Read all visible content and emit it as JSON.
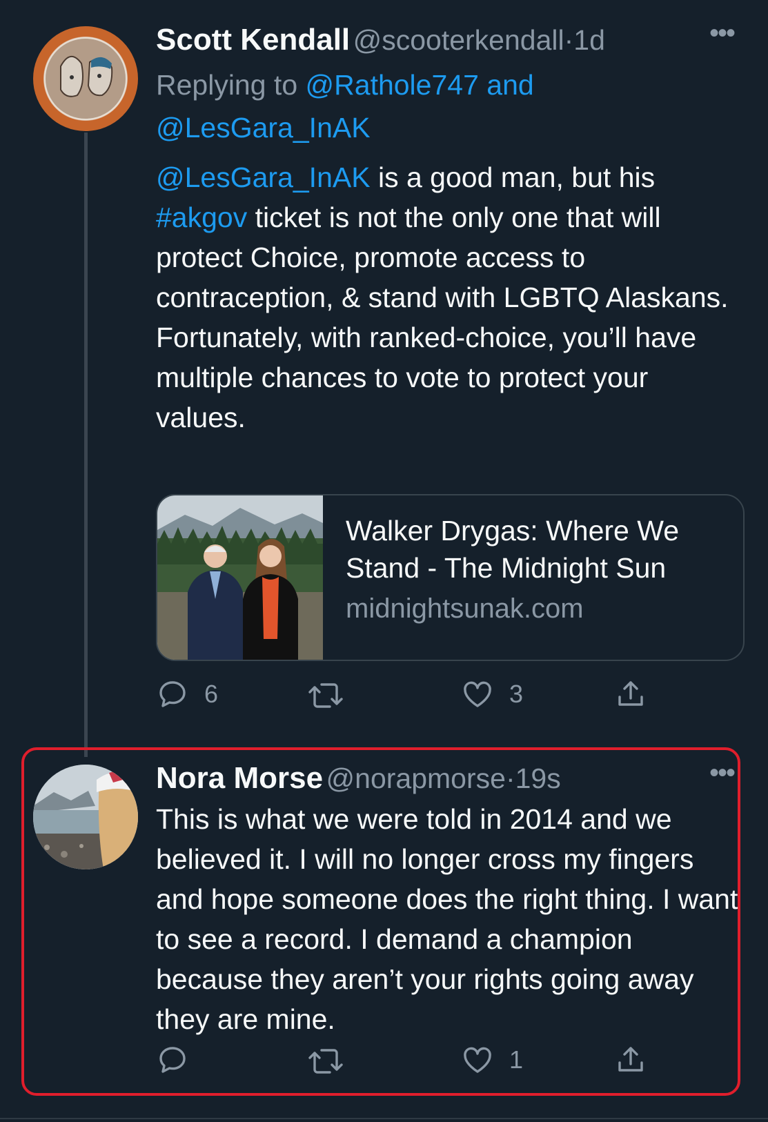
{
  "tweet1": {
    "author_name": "Scott Kendall",
    "handle": "@scooterkendall",
    "separator": "·",
    "time": "1d",
    "replying_prefix": "Replying to",
    "replying_user1": "@Rathole747",
    "replying_and": "and",
    "replying_user2": "@LesGara_InAK",
    "body_mention": "@LesGara_InAK",
    "body_text1": " is a good man, but his ",
    "body_hashtag": "#akgov",
    "body_text2": " ticket is not the only one that will protect Choice, promote access to contraception, & stand with LGBTQ Alaskans.",
    "body_text3": "Fortunately, with ranked-choice, you’ll have multiple chances to vote to protect your values.",
    "card": {
      "title": "Walker Drygas: Where We Stand - The Midnight Sun",
      "domain": "midnightsunak.com"
    },
    "replies": "6",
    "retweets": "",
    "likes": "3"
  },
  "tweet2": {
    "author_name": "Nora Morse",
    "handle": "@norapmorse",
    "separator": "·",
    "time": "19s",
    "body": "This is what we were told in 2014 and we believed it. I will no longer cross my fingers and hope someone does the right thing. I want to see a record. I demand a champion because they aren’t your rights going away they are mine.",
    "replies": "",
    "retweets": "",
    "likes": "1"
  },
  "more_label": "•••",
  "colors": {
    "background": "#15202b",
    "text": "#f7f9f9",
    "secondary": "#8b98a5",
    "link": "#1d9bf0",
    "highlight": "#e01e2c"
  },
  "icons": [
    "reply-icon",
    "retweet-icon",
    "like-icon",
    "share-icon",
    "more-icon"
  ]
}
